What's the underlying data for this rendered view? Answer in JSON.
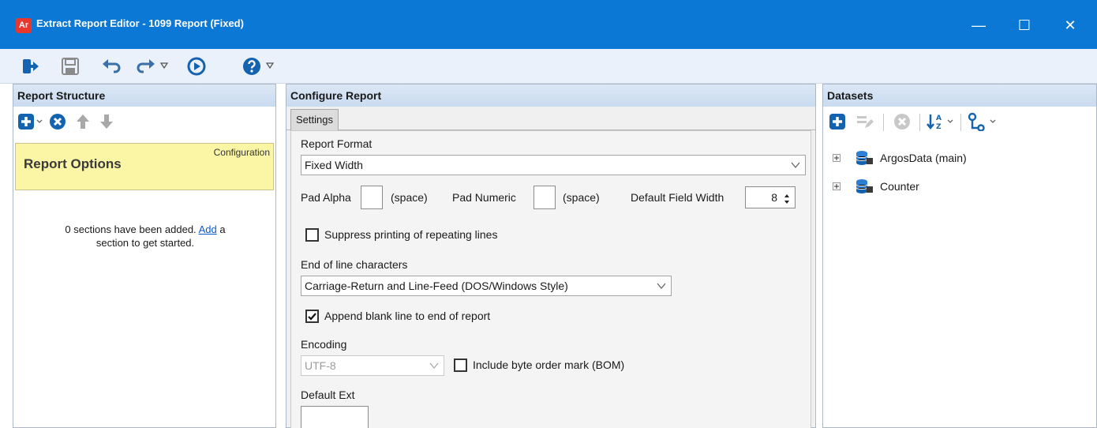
{
  "window": {
    "app_badge": "Ar",
    "title": "Extract Report Editor - 1099 Report (Fixed)",
    "minimize_glyph": "—",
    "maximize_glyph": "☐",
    "close_glyph": "✕"
  },
  "colors": {
    "titlebar": "#0a78d4",
    "accent_icon": "#1463b0",
    "report_options_bg": "#fbf6a6",
    "panel_header": "#c9dbef",
    "link": "#0a5bd1"
  },
  "toolbar": {
    "icons": [
      "exit-icon",
      "save-icon",
      "undo-icon",
      "redo-icon",
      "run-icon",
      "help-icon"
    ]
  },
  "report_structure": {
    "header": "Report Structure",
    "card_title": "Report Options",
    "card_tag": "Configuration",
    "empty_prefix": "0 sections have been added.",
    "empty_link": "Add",
    "empty_suffix_1": "a",
    "empty_suffix_2": "section to get started."
  },
  "configure_report": {
    "header": "Configure Report",
    "tab": "Settings",
    "report_format_label": "Report Format",
    "report_format_value": "Fixed Width",
    "pad_alpha_label": "Pad Alpha",
    "pad_alpha_hint": "(space)",
    "pad_numeric_label": "Pad Numeric",
    "pad_numeric_hint": "(space)",
    "default_field_width_label": "Default Field Width",
    "default_field_width_value": "8",
    "suppress_label": "Suppress printing of repeating lines",
    "suppress_checked": false,
    "eol_label": "End of line characters",
    "eol_value": "Carriage-Return and Line-Feed (DOS/Windows Style)",
    "append_blank_label": "Append blank line to end of report",
    "append_blank_checked": true,
    "encoding_label": "Encoding",
    "encoding_value": "UTF-8",
    "bom_label": "Include byte order mark (BOM)",
    "bom_checked": false,
    "default_ext_label": "Default Ext",
    "default_ext_value": ""
  },
  "datasets": {
    "header": "Datasets",
    "items": [
      {
        "label": "ArgosData (main)"
      },
      {
        "label": "Counter"
      }
    ]
  }
}
